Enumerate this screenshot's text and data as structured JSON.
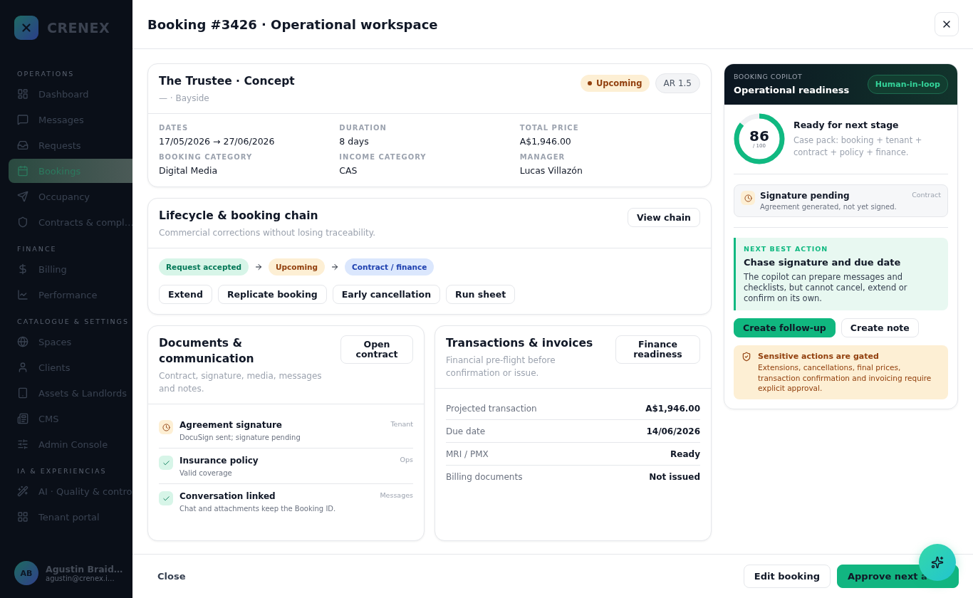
{
  "sidebar": {
    "logo": "CRENEX",
    "sections": [
      {
        "title": "OPERATIONS",
        "items": [
          {
            "label": "Dashboard",
            "selected": false
          },
          {
            "label": "Messages",
            "selected": false
          },
          {
            "label": "Requests",
            "selected": false
          },
          {
            "label": "Bookings",
            "selected": true
          },
          {
            "label": "Occupancy",
            "selected": false
          },
          {
            "label": "Contracts & compl…",
            "selected": false
          }
        ]
      },
      {
        "title": "FINANCE",
        "items": [
          {
            "label": "Billing",
            "selected": false
          },
          {
            "label": "Performance",
            "selected": false
          }
        ]
      },
      {
        "title": "CATALOGUE & SETTINGS",
        "items": [
          {
            "label": "Spaces",
            "selected": false
          },
          {
            "label": "Clients",
            "selected": false
          },
          {
            "label": "Assets & Landlords",
            "selected": false
          },
          {
            "label": "CMS",
            "selected": false
          },
          {
            "label": "Admin Console",
            "selected": false
          }
        ]
      },
      {
        "title": "IA & EXPERIENCIAS",
        "items": [
          {
            "label": "AI · Quality & contro",
            "selected": false
          },
          {
            "label": "Tenant portal",
            "selected": false
          }
        ]
      }
    ],
    "user": {
      "initials": "AB",
      "name": "Agustin Braid…",
      "email": "agustin@crenex.i…"
    }
  },
  "modal": {
    "title": "Booking #3426 · Operational workspace",
    "booking": {
      "title": "The Trustee · Concept",
      "subtitle": "— · Bayside",
      "status": "Upcoming",
      "tag": "AR 1.5",
      "fields": [
        {
          "label": "DATES",
          "value": "17/05/2026 → 27/06/2026"
        },
        {
          "label": "DURATION",
          "value": "8 days"
        },
        {
          "label": "TOTAL PRICE",
          "value": "A$1,946.00"
        },
        {
          "label": "BOOKING CATEGORY",
          "value": "Digital Media"
        },
        {
          "label": "INCOME CATEGORY",
          "value": "CAS"
        },
        {
          "label": "MANAGER",
          "value": "Lucas Villazón"
        }
      ]
    },
    "lifecycle": {
      "title": "Lifecycle & booking chain",
      "description": "Commercial corrections without losing traceability.",
      "button": "View chain",
      "steps": [
        {
          "label": "Request accepted",
          "kind": "success"
        },
        {
          "label": "Upcoming",
          "kind": "warning"
        },
        {
          "label": "Contract / finance",
          "kind": "info"
        }
      ],
      "actions": [
        "Extend",
        "Replicate booking",
        "Early cancellation",
        "Run sheet"
      ]
    },
    "documents": {
      "title": "Documents & communication",
      "description": "Contract, signature, media, messages and notes.",
      "button": "Open contract",
      "items": [
        {
          "title": "Agreement signature",
          "detail": "DocuSign sent; signature pending",
          "tag": "Tenant",
          "kind": "pending"
        },
        {
          "title": "Insurance policy",
          "detail": "Valid coverage",
          "tag": "Ops",
          "kind": "done"
        },
        {
          "title": "Conversation linked",
          "detail": "Chat and attachments keep the Booking ID.",
          "tag": "Messages",
          "kind": "done"
        }
      ]
    },
    "transactions": {
      "title": "Transactions & invoices",
      "description": "Financial pre-flight before confirmation or issue.",
      "button": "Finance readiness",
      "rows": [
        {
          "label": "Projected transaction",
          "value": "A$1,946.00"
        },
        {
          "label": "Due date",
          "value": "14/06/2026"
        },
        {
          "label": "MRI / PMX",
          "value": "Ready"
        },
        {
          "label": "Billing documents",
          "value": "Not issued"
        }
      ]
    },
    "copilot": {
      "eyebrow": "BOOKING COPILOT",
      "title": "Operational readiness",
      "badge": "Human-in-loop",
      "score": {
        "value": "86",
        "max": "/ 100",
        "level": 0.86
      },
      "heading": "Ready for next stage",
      "text": "Case pack: booking + tenant + contract + policy + finance.",
      "alert": {
        "title": "Signature pending",
        "detail": "Agreement generated, not yet signed.",
        "tag": "Contract"
      },
      "action": {
        "eyebrow": "NEXT BEST ACTION",
        "title": "Chase signature and due date",
        "text": "The copilot can prepare messages and checklists, but cannot cancel, extend or confirm on its own."
      },
      "buttons": [
        {
          "label": "Create follow-up",
          "kind": "primary"
        },
        {
          "label": "Create note",
          "kind": "secondary"
        }
      ],
      "gate": {
        "title": "Sensitive actions are gated",
        "text": "Extensions, cancellations, final prices, transaction confirmation and invoicing require explicit approval."
      }
    },
    "footer": {
      "close": "Close",
      "buttons": [
        {
          "label": "Edit booking",
          "kind": "secondary"
        },
        {
          "label": "Approve next a",
          "kind": "primary"
        }
      ]
    }
  }
}
